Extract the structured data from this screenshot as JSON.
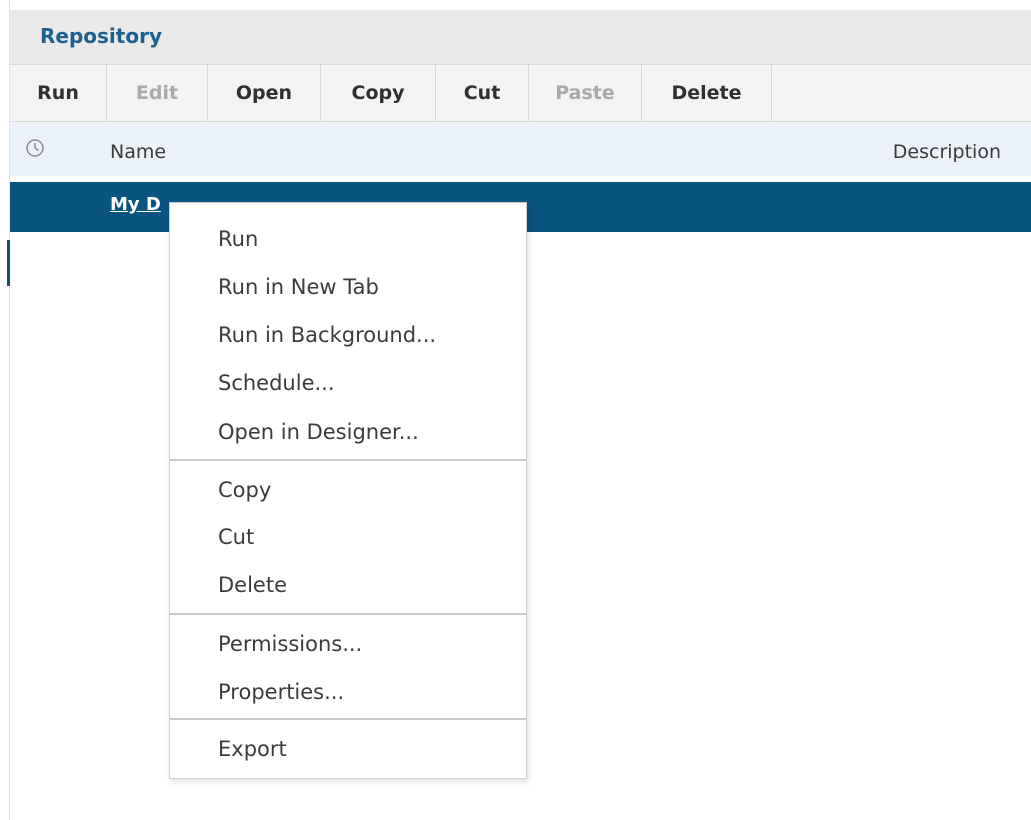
{
  "header": {
    "title": "Repository"
  },
  "toolbar": {
    "buttons": [
      {
        "label": "Run",
        "enabled": true
      },
      {
        "label": "Edit",
        "enabled": false
      },
      {
        "label": "Open",
        "enabled": true
      },
      {
        "label": "Copy",
        "enabled": true
      },
      {
        "label": "Cut",
        "enabled": true
      },
      {
        "label": "Paste",
        "enabled": false
      },
      {
        "label": "Delete",
        "enabled": true
      }
    ]
  },
  "columns": {
    "icon": "clock-icon",
    "name_label": "Name",
    "description_label": "Description"
  },
  "rows": [
    {
      "name": "My D",
      "selected": true
    }
  ],
  "context_menu": {
    "groups": [
      [
        "Run",
        "Run in New Tab",
        "Run in Background...",
        "Schedule...",
        "Open in Designer..."
      ],
      [
        "Copy",
        "Cut",
        "Delete"
      ],
      [
        "Permissions...",
        "Properties..."
      ],
      [
        "Export"
      ]
    ]
  },
  "colors": {
    "title": "#1d5f8f",
    "selected_row": "#0a5482",
    "header_bg": "#eaf1f9",
    "toolbar_bg": "#f3f3f3"
  }
}
